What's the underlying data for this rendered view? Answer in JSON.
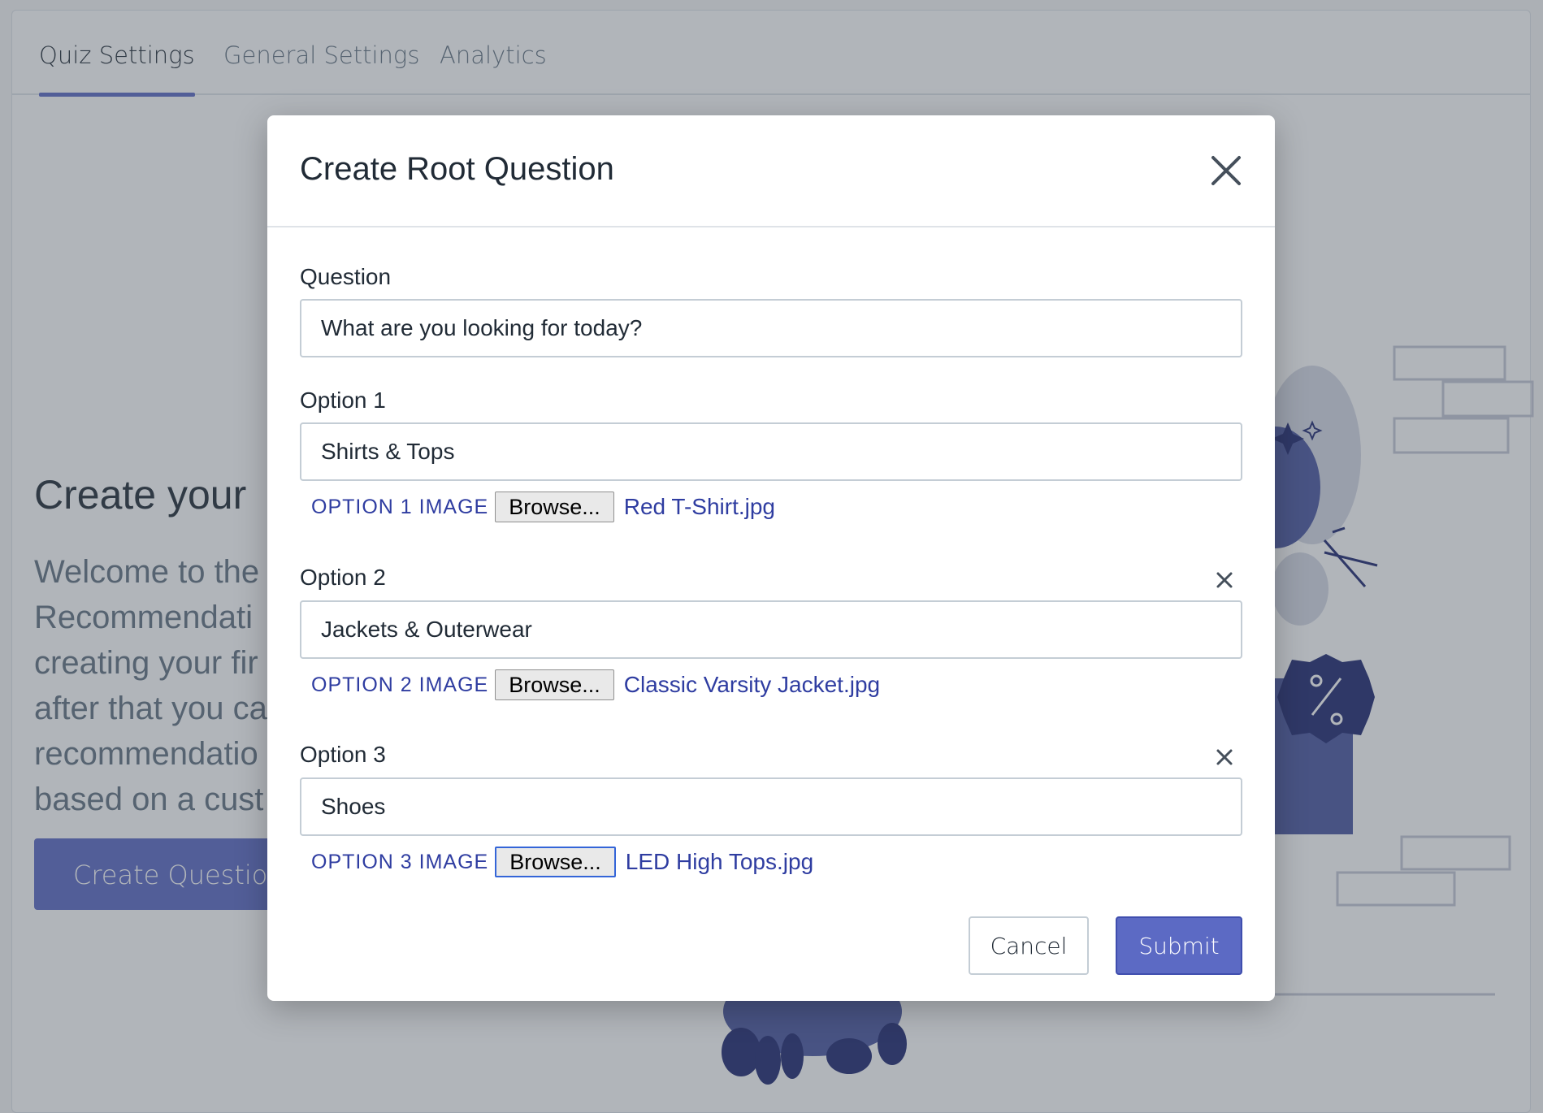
{
  "tabs": [
    {
      "label": "Quiz Settings",
      "active": true
    },
    {
      "label": "General Settings",
      "active": false
    },
    {
      "label": "Analytics",
      "active": false
    }
  ],
  "hero": {
    "title": "Create your",
    "text_lines": [
      "Welcome to the",
      "Recommendati",
      "creating your fir",
      "after that you ca",
      "recommendatio",
      "based on a cust"
    ],
    "button_label": "Create Question"
  },
  "modal": {
    "title": "Create Root Question",
    "question": {
      "label": "Question",
      "value": "What are you looking for today?"
    },
    "options": [
      {
        "label": "Option 1",
        "value": "Shirts & Tops",
        "image_label": "OPTION 1 IMAGE",
        "browse_label": "Browse...",
        "file_name": "Red T-Shirt.jpg",
        "removable": false
      },
      {
        "label": "Option 2",
        "value": "Jackets & Outerwear",
        "image_label": "OPTION 2 IMAGE",
        "browse_label": "Browse...",
        "file_name": "Classic Varsity Jacket.jpg",
        "removable": true
      },
      {
        "label": "Option 3",
        "value": "Shoes",
        "image_label": "OPTION 3 IMAGE",
        "browse_label": "Browse...",
        "file_name": "LED High Tops.jpg",
        "removable": true
      }
    ],
    "cancel_label": "Cancel",
    "submit_label": "Submit"
  },
  "icons": {
    "close": "close-icon",
    "remove": "remove-icon"
  },
  "colors": {
    "accent": "#5c6ac4",
    "link": "#2f3da1",
    "text": "#212b36"
  }
}
